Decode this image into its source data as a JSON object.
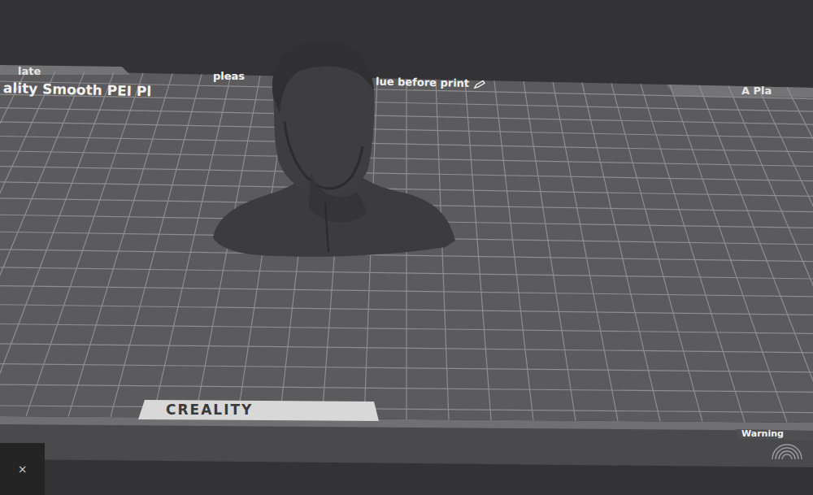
{
  "plate": {
    "tab_left": "late",
    "name": "ality Smooth PEI Pl",
    "notice_left": "pleas",
    "notice_right": "lue before print",
    "tab_right": "A Pla",
    "brand": "CREALITY",
    "warning": "Warning"
  },
  "panel": {
    "close": "×"
  }
}
